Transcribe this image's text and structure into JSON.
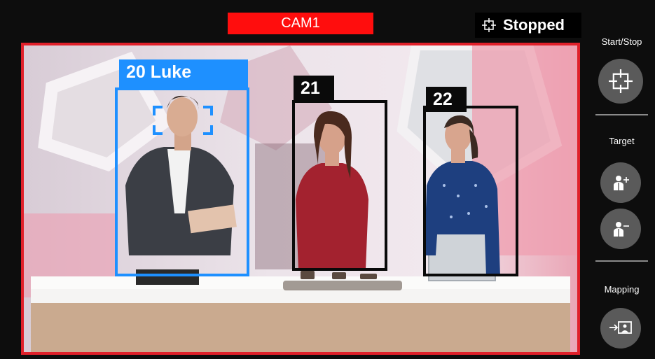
{
  "camera": {
    "name": "CAM1"
  },
  "status": {
    "text": "Stopped",
    "icon": "crosshair-icon"
  },
  "tracks": [
    {
      "id": "20",
      "label": "20 Luke",
      "selected": true
    },
    {
      "id": "21",
      "label": "21",
      "selected": false
    },
    {
      "id": "22",
      "label": "22",
      "selected": false
    }
  ],
  "sidebar": {
    "start_stop": {
      "label": "Start/Stop",
      "icon": "crosshair-icon"
    },
    "target": {
      "label": "Target",
      "add_icon": "add-person-icon",
      "remove_icon": "remove-person-icon"
    },
    "mapping": {
      "label": "Mapping",
      "icon": "mapping-icon"
    }
  },
  "colors": {
    "camera_red": "#ff0d0d",
    "frame_red": "#e0202a",
    "selected_blue": "#1e90ff",
    "box_black": "#0a0a0a",
    "button_gray": "#5a5a5a"
  }
}
